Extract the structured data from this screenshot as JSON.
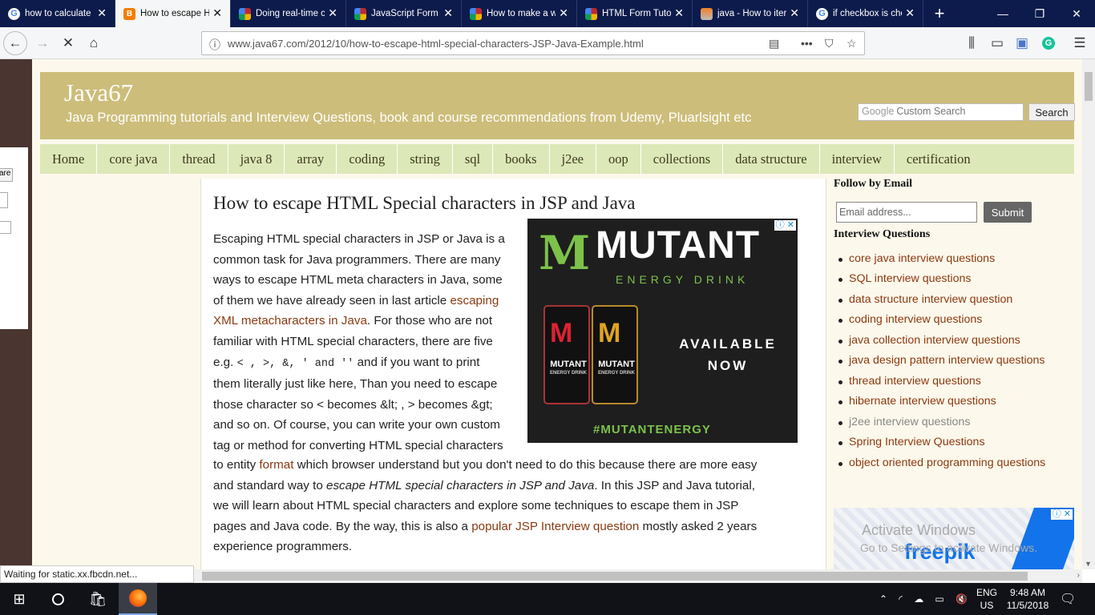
{
  "tabs": [
    {
      "label": "how to calculate",
      "favicon": "google-icon",
      "color": "#4285f4"
    },
    {
      "label": "How to escape H",
      "favicon": "blogger-icon",
      "color": "#f57d00",
      "active": true
    },
    {
      "label": "Doing real-time c",
      "favicon": "colorgrid-icon",
      "color": "#c1272d"
    },
    {
      "label": "JavaScript Form",
      "favicon": "colorgrid-icon",
      "color": "#c1272d"
    },
    {
      "label": "How to make a w",
      "favicon": "colorgrid-icon",
      "color": "#c1272d"
    },
    {
      "label": "HTML Form Tutor",
      "favicon": "colorgrid-icon",
      "color": "#c1272d"
    },
    {
      "label": "java - How to iter",
      "favicon": "stackoverflow-icon",
      "color": "#f48024"
    },
    {
      "label": "if checkbox is che",
      "favicon": "google-icon",
      "color": "#4285f4"
    }
  ],
  "url": "www.java67.com/2012/10/how-to-escape-html-special-characters-JSP-Java-Example.html",
  "left_panel": {
    "button": "are"
  },
  "site": {
    "title": "Java67",
    "tagline": "Java Programming tutorials and Interview Questions, book and course recommendations from Udemy, Pluarlsight etc",
    "search_brand": "Google",
    "search_placeholder": "Custom Search",
    "search_button": "Search"
  },
  "menu": [
    "Home",
    "core java",
    "thread",
    "java 8",
    "array",
    "coding",
    "string",
    "sql",
    "books",
    "j2ee",
    "oop",
    "collections",
    "data structure",
    "interview",
    "certification"
  ],
  "article": {
    "title": "How to escape HTML Special characters in JSP and Java",
    "l1": "Escaping HTML special characters in JSP or Java is a",
    "l2": "common task for Java programmers. There are many",
    "l3": "ways to escape HTML meta characters in Java, some",
    "l4a": "of them we have already seen in last article ",
    "l4link": "escaping",
    "l5link": "XML metacharacters in Java",
    "l5b": ".  For those who are not",
    "l6": "familiar with HTML special characters, there are five",
    "l7a": "e.g. ",
    "l7code": "< , >, &, ' and ''",
    "l7b": " and if you want to print",
    "l8": "them literally just like here, Than you need to escape",
    "l9": "those character so < becomes &lt; , > becomes &gt;",
    "l10": "and so on. Of course, you can write your own custom",
    "l11": "tag or method for converting HTML special characters",
    "l12a": "to entity ",
    "l12link": "format",
    "l12b": " which browser understand but you don't need to do this because there are more easy",
    "l13a": "and standard way to ",
    "l13i": "escape HTML special characters in JSP and Java",
    "l13b": ". In this JSP and Java tutorial,",
    "l14": "we will learn about HTML special characters and explore some techniques to escape them in JSP",
    "l15a": "pages and Java code. By the way, this is also a ",
    "l15link": "popular JSP Interview question",
    "l15b": " mostly asked 2 years",
    "l16": "experience programmers."
  },
  "ad": {
    "brand": "MUTANT",
    "sub": "ENERGY DRINK",
    "avail1": "AVAILABLE",
    "avail2": "NOW",
    "hashtag": "#MUTANTENERGY",
    "can": "MUTANT",
    "can_sub": "ENERGY DRINK"
  },
  "sidebar": {
    "follow_heading": "Follow by Email",
    "email_placeholder": "Email address...",
    "submit": "Submit",
    "iq_heading": "Interview Questions",
    "links": [
      "core java interview questions",
      "SQL interview questions",
      "data structure interview question",
      "coding interview questions",
      "java collection interview questions",
      "java design pattern interview questions",
      "thread interview questions",
      "hibernate interview questions",
      "j2ee interview questions",
      "Spring Interview Questions",
      "object oriented programming questions"
    ]
  },
  "ad2": {
    "watermark1": "Activate Windows",
    "watermark2": "Go to Settings to activate Windows.",
    "brand": "freepik"
  },
  "status": "Waiting for static.xx.fbcdn.net...",
  "tray": {
    "lang1": "ENG",
    "lang2": "US",
    "time": "9:48 AM",
    "date": "11/5/2018"
  }
}
